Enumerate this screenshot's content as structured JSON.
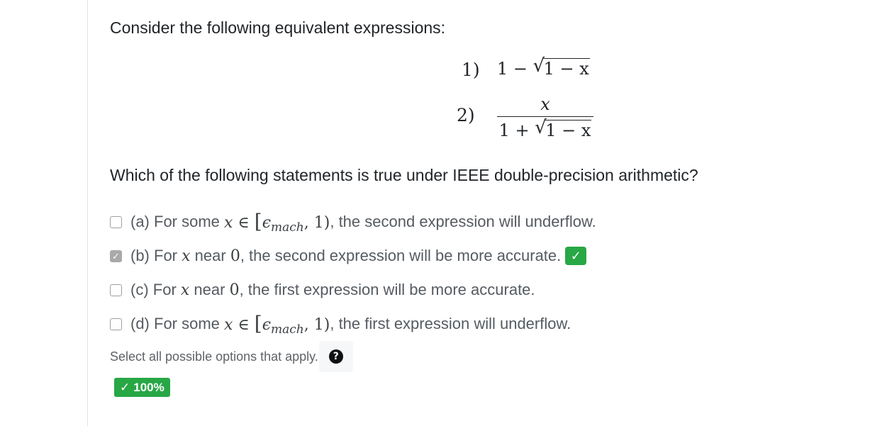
{
  "intro": "Consider the following equivalent expressions:",
  "expressions": [
    {
      "number": "1)",
      "lead": "1 − ",
      "radicand": "1 − x"
    },
    {
      "number": "2)",
      "numerator": "x",
      "den_lead": "1 + ",
      "radicand": "1 − x"
    }
  ],
  "question": "Which of the following statements is true under IEEE double-precision arithmetic?",
  "options": [
    {
      "label": "(a) For some",
      "var": "x",
      "rel": "∈",
      "interval_open": "[",
      "eps": "ϵ",
      "eps_sub": "mach",
      "interval_rest": ", 1)",
      "rest": ", the second expression will underflow.",
      "checked": false
    },
    {
      "label": "(b) For",
      "var": "x",
      "near": " near ",
      "zero": "0",
      "rest": ", the second expression will be more accurate.",
      "checked": true,
      "correct": true
    },
    {
      "label": "(c) For",
      "var": "x",
      "near": " near ",
      "zero": "0",
      "rest": ", the first expression will be more accurate.",
      "checked": false
    },
    {
      "label": "(d) For some",
      "var": "x",
      "rel": "∈",
      "interval_open": "[",
      "eps": "ϵ",
      "eps_sub": "mach",
      "interval_rest": ", 1)",
      "rest": ", the first expression will underflow.",
      "checked": false
    }
  ],
  "hint": "Select all possible options that apply.",
  "help_icon": "question-circle-icon",
  "score": "100%",
  "colors": {
    "success": "#28a745",
    "checked_box": "#a9a9a9",
    "text_muted": "#555b61"
  }
}
